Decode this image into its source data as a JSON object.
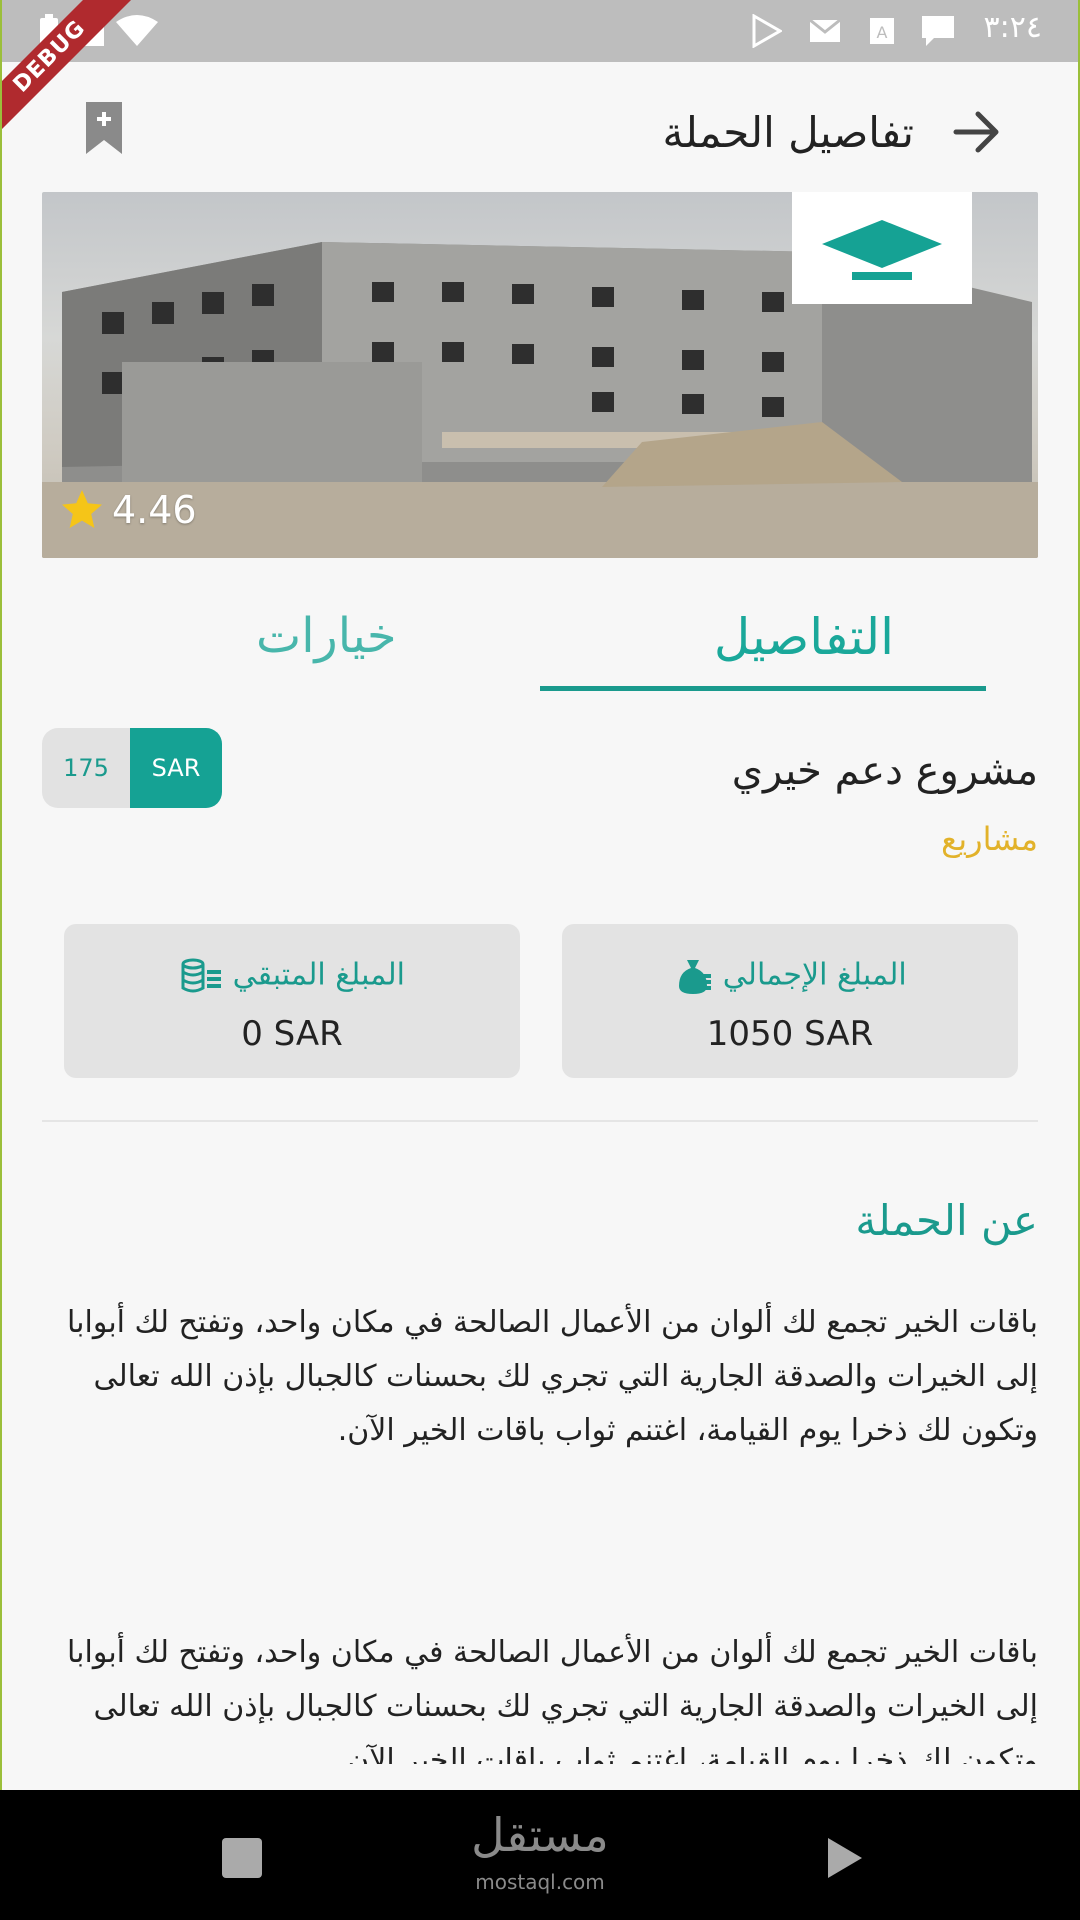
{
  "status_bar": {
    "time": "٣:٢٤",
    "debug_label": "DEBUG",
    "icons": [
      "battery-icon",
      "wifi-icon",
      "play-store-icon",
      "gmail-icon",
      "keyboard-icon",
      "chat-icon"
    ]
  },
  "header": {
    "title": "تفاصيل الحملة",
    "back_icon": "arrow-right-icon",
    "bookmark_icon": "bookmark-add-icon"
  },
  "hero": {
    "rating": "4.46",
    "rating_icon": "star-icon"
  },
  "tabs": [
    {
      "label": "التفاصيل",
      "active": true
    },
    {
      "label": "خيارات",
      "active": false
    }
  ],
  "project": {
    "title": "مشروع دعم خيري",
    "category": "مشاريع",
    "price_value": "175",
    "price_currency": "SAR"
  },
  "stats": {
    "total": {
      "label": "المبلغ الإجمالي",
      "value": "1050 SAR",
      "icon": "money-bag-icon"
    },
    "remaining": {
      "label": "المبلغ المتبقي",
      "value": "0 SAR",
      "icon": "coins-stack-icon"
    }
  },
  "about": {
    "heading": "عن الحملة",
    "paragraph_1": "باقات الخير تجمع لك ألوان من الأعمال الصالحة في مكان واحد، وتفتح لك أبوابا إلى الخيرات والصدقة الجارية التي تجري لك بحسنات كالجبال بإذن الله تعالى وتكون لك ذخرا يوم القيامة، اغتنم ثواب باقات الخير الآن.",
    "paragraph_2": "باقات الخير تجمع لك ألوان من الأعمال الصالحة في مكان واحد، وتفتح لك أبوابا إلى الخيرات والصدقة الجارية التي تجري لك بحسنات كالجبال بإذن الله تعالى وتكون لك ذخرا يوم القيامة، اغتنم ثواب باقات الخير الآن."
  },
  "nav_bar": {
    "watermark": "مستقل",
    "watermark_sub": "mostaql.com"
  },
  "colors": {
    "accent": "#1a9a8d",
    "category": "#e2b22a",
    "star": "#f5c518"
  }
}
